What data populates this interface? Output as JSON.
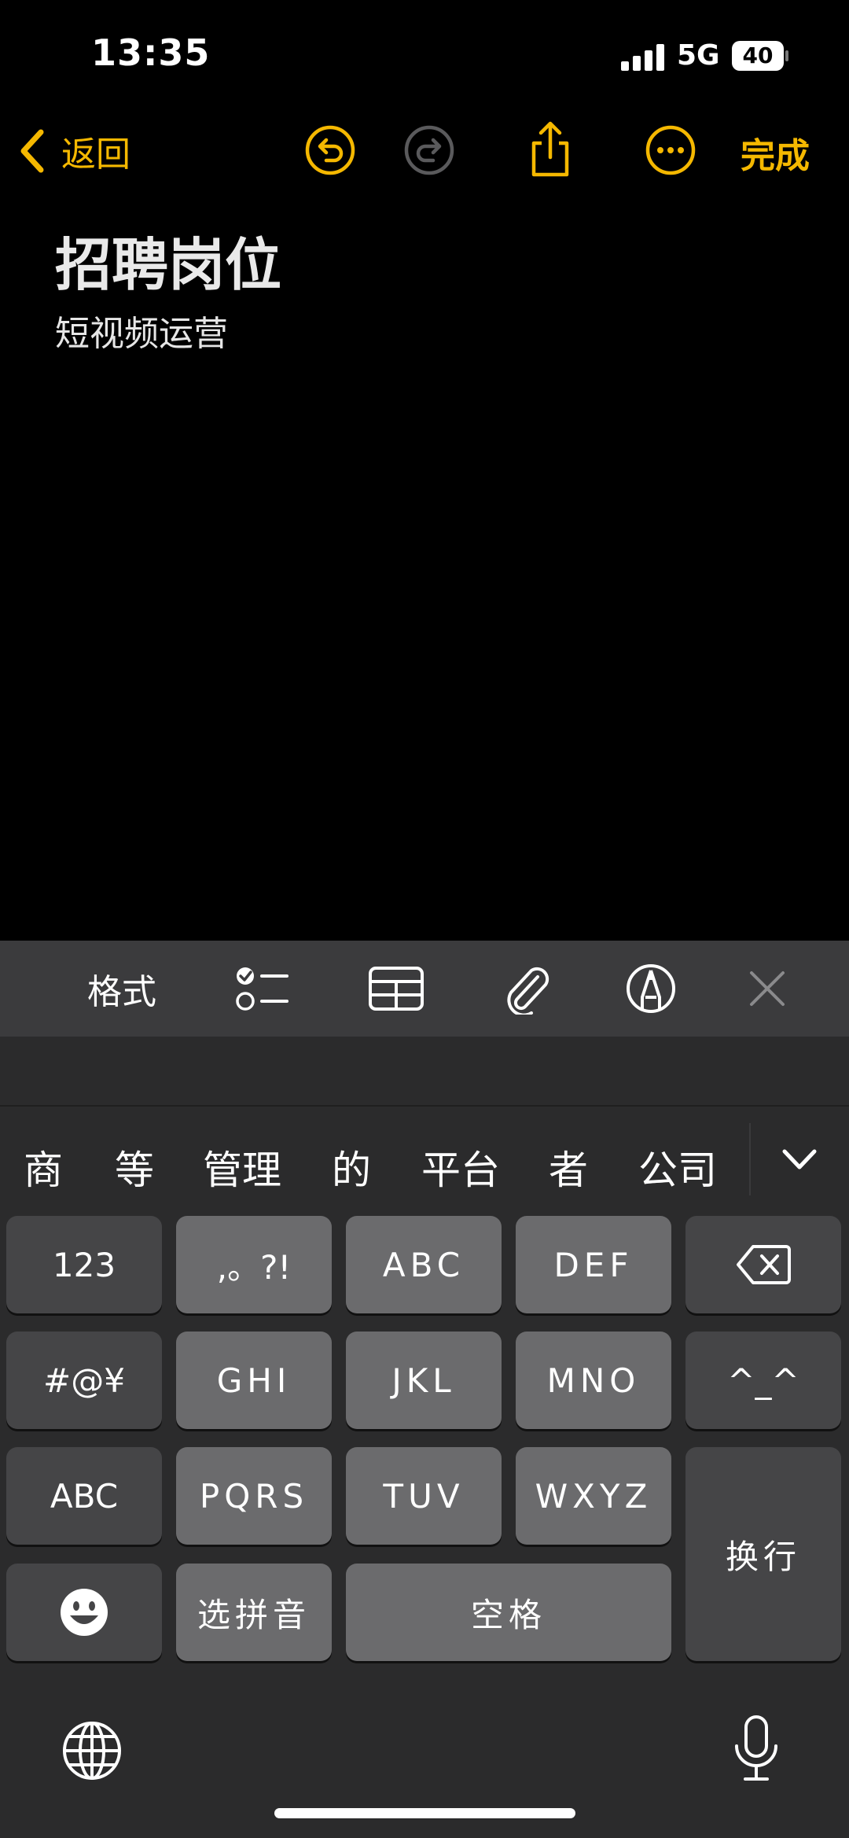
{
  "status": {
    "time": "13:35",
    "network": "5G",
    "battery": "40"
  },
  "nav": {
    "back_label": "返回",
    "done_label": "完成"
  },
  "note": {
    "title": "招聘岗位",
    "body": "短视频运营"
  },
  "format_bar": {
    "format_label": "格式"
  },
  "candidates": [
    "商",
    "等",
    "管理",
    "的",
    "平台",
    "者",
    "公司"
  ],
  "keys": {
    "row1": [
      "123",
      ",。?!",
      "ABC",
      "DEF"
    ],
    "row2": [
      "#@¥",
      "GHI",
      "JKL",
      "MNO",
      "^_^"
    ],
    "row3": [
      "ABC",
      "PQRS",
      "TUV",
      "WXYZ"
    ],
    "enter": "换行",
    "row4": [
      "选拼音",
      "空格"
    ]
  },
  "colors": {
    "accent": "#f5b800",
    "background": "#000000",
    "keyboard": "#2b2b2c"
  }
}
